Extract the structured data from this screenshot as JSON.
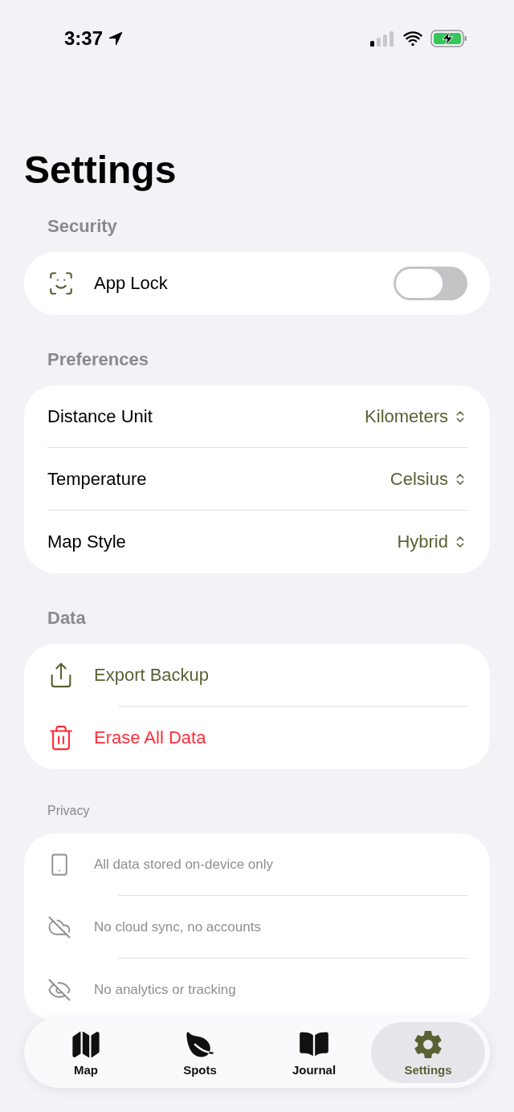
{
  "status_bar": {
    "time": "3:37"
  },
  "title": "Settings",
  "sections": [
    {
      "header": "Security",
      "rows": [
        {
          "kind": "toggle",
          "label": "App Lock",
          "on": false
        }
      ]
    },
    {
      "header": "Preferences",
      "rows": [
        {
          "kind": "picker",
          "label": "Distance Unit",
          "value": "Kilometers"
        },
        {
          "kind": "picker",
          "label": "Temperature",
          "value": "Celsius"
        },
        {
          "kind": "picker",
          "label": "Map Style",
          "value": "Hybrid"
        }
      ]
    },
    {
      "header": "Data",
      "rows": [
        {
          "kind": "action",
          "label": "Export Backup",
          "destructive": false
        },
        {
          "kind": "action",
          "label": "Erase All Data",
          "destructive": true
        }
      ]
    },
    {
      "header": "Privacy",
      "rows": [
        {
          "kind": "info",
          "label": "All data stored on-device only"
        },
        {
          "kind": "info",
          "label": "No cloud sync, no accounts"
        },
        {
          "kind": "info",
          "label": "No analytics or tracking"
        }
      ]
    }
  ],
  "tabs": [
    {
      "label": "Map",
      "selected": false
    },
    {
      "label": "Spots",
      "selected": false
    },
    {
      "label": "Journal",
      "selected": false
    },
    {
      "label": "Settings",
      "selected": true
    }
  ]
}
